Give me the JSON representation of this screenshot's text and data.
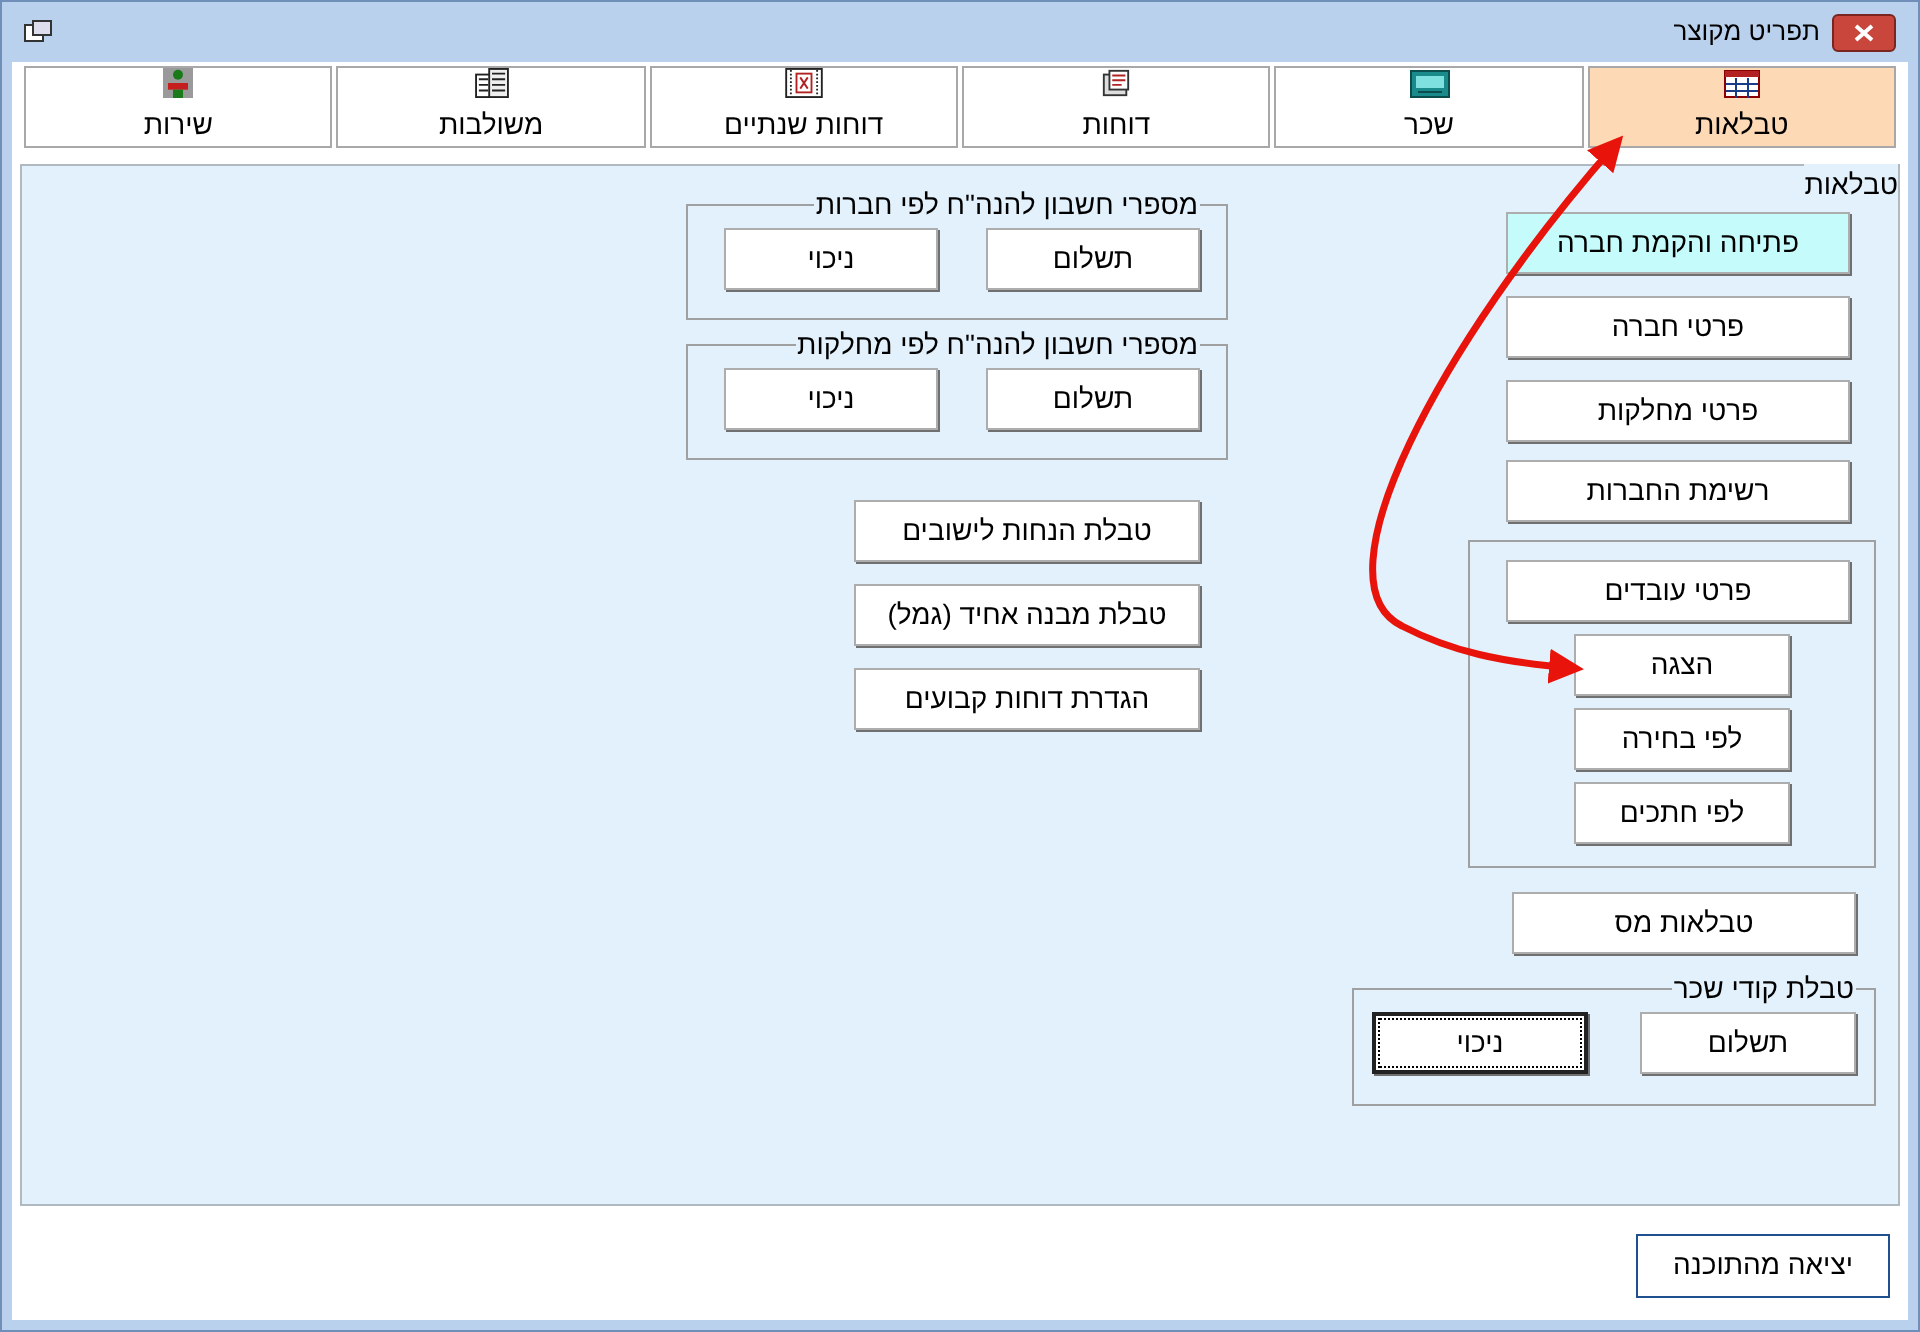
{
  "window": {
    "title": "תפריט מקוצר"
  },
  "tabs": [
    {
      "label": "טבלאות",
      "selected": true
    },
    {
      "label": "שכר",
      "selected": false
    },
    {
      "label": "דוחות",
      "selected": false
    },
    {
      "label": "דוחות שנתיים",
      "selected": false
    },
    {
      "label": "משולבות",
      "selected": false
    },
    {
      "label": "שירות",
      "selected": false
    }
  ],
  "panel": {
    "title": "טבלאות",
    "main_buttons": [
      {
        "label": "פתיחה והקמת חברה",
        "highlighted": true
      },
      {
        "label": "פרטי חברה",
        "highlighted": false
      },
      {
        "label": "פרטי מחלקות",
        "highlighted": false
      },
      {
        "label": "רשימת החברות",
        "highlighted": false
      }
    ],
    "employees_group": {
      "button": "פרטי עובדים",
      "sub_buttons": [
        "הצגה",
        "לפי בחירה",
        "לפי חתכים"
      ]
    },
    "tax_button": "טבלאות מס",
    "wage_codes_group": {
      "title": "טבלת קודי שכר",
      "buttons": [
        {
          "label": "תשלום",
          "focused": false
        },
        {
          "label": "ניכוי",
          "focused": true
        }
      ]
    },
    "account_groups": [
      {
        "title": "מספרי חשבון להנה\"ח לפי חברות",
        "buttons": [
          "תשלום",
          "ניכוי"
        ]
      },
      {
        "title": "מספרי חשבון להנה\"ח לפי מחלקות",
        "buttons": [
          "תשלום",
          "ניכוי"
        ]
      }
    ],
    "table_buttons": [
      "טבלת הנחות לישובים",
      "טבלת מבנה אחיד (גמל)",
      "הגדרת דוחות קבועים"
    ]
  },
  "exit_button": "יציאה מהתוכנה"
}
